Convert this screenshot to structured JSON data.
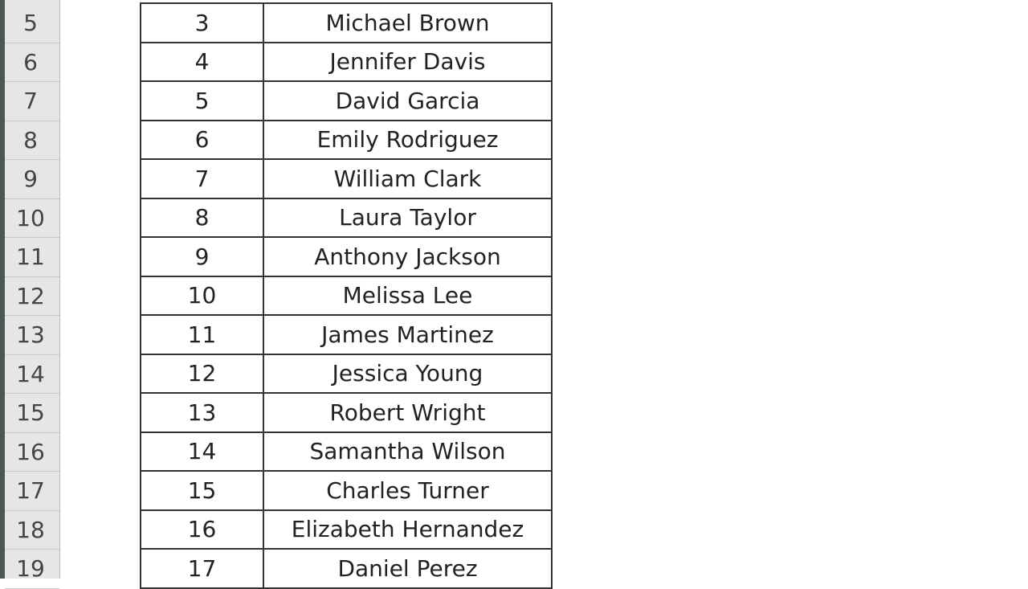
{
  "sheet": {
    "rows": [
      {
        "row": "5",
        "num": "3",
        "name": "Michael Brown"
      },
      {
        "row": "6",
        "num": "4",
        "name": "Jennifer Davis"
      },
      {
        "row": "7",
        "num": "5",
        "name": "David Garcia"
      },
      {
        "row": "8",
        "num": "6",
        "name": "Emily Rodriguez"
      },
      {
        "row": "9",
        "num": "7",
        "name": "William Clark"
      },
      {
        "row": "10",
        "num": "8",
        "name": "Laura Taylor"
      },
      {
        "row": "11",
        "num": "9",
        "name": "Anthony Jackson"
      },
      {
        "row": "12",
        "num": "10",
        "name": "Melissa Lee"
      },
      {
        "row": "13",
        "num": "11",
        "name": "James Martinez"
      },
      {
        "row": "14",
        "num": "12",
        "name": "Jessica Young"
      },
      {
        "row": "15",
        "num": "13",
        "name": "Robert Wright"
      },
      {
        "row": "16",
        "num": "14",
        "name": "Samantha Wilson"
      },
      {
        "row": "17",
        "num": "15",
        "name": "Charles Turner"
      },
      {
        "row": "18",
        "num": "16",
        "name": "Elizabeth Hernandez"
      },
      {
        "row": "19",
        "num": "17",
        "name": "Daniel Perez"
      }
    ]
  }
}
